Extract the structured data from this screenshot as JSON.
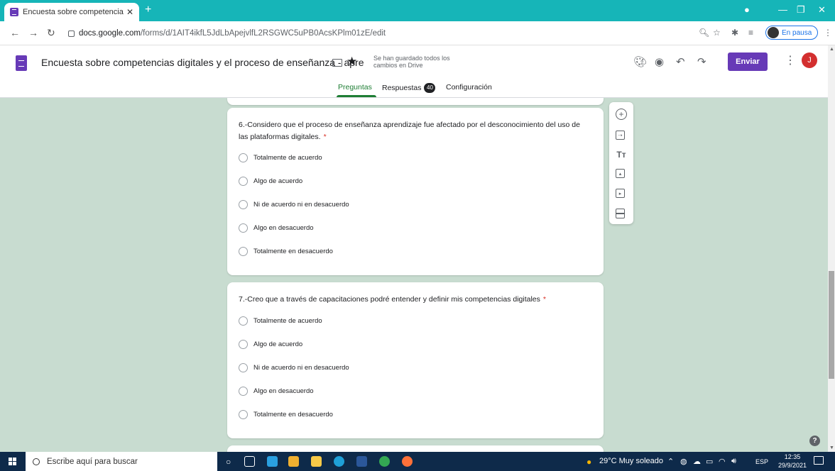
{
  "browser": {
    "tab_title": "Encuesta sobre competencias dig",
    "tab_close": "✕",
    "new_tab": "+",
    "url_host": "docs.google.com",
    "url_path": "/forms/d/1AIT4ikfL5JdLbApejvlfL2RSGWC5uPB0AcsKPlm01zE/edit",
    "profile_status": "En pausa"
  },
  "form_header": {
    "title": "Encuesta sobre competencias digitales y el proceso de enseñanza - apre",
    "save_status_line1": "Se han guardado todos los",
    "save_status_line2": "cambios en Drive",
    "send_label": "Enviar",
    "user_initial": "J",
    "tabs": {
      "questions": "Preguntas",
      "responses": "Respuestas",
      "responses_count": "40",
      "settings": "Configuración"
    }
  },
  "questions": [
    {
      "title": "6.-Considero que el proceso de enseñanza aprendizaje fue afectado por el desconocimiento del uso de las plataformas digitales.",
      "required_mark": "*",
      "options": [
        "Totalmente de acuerdo",
        "Algo de acuerdo",
        "Ni de acuerdo ni en desacuerdo",
        "Algo en desacuerdo",
        "Totalmente en desacuerdo"
      ]
    },
    {
      "title": "7.-Creo que a través de capacitaciones podré entender y definir mis competencias digitales",
      "required_mark": "*",
      "options": [
        "Totalmente de acuerdo",
        "Algo de acuerdo",
        "Ni de acuerdo ni en desacuerdo",
        "Algo en desacuerdo",
        "Totalmente en desacuerdo"
      ]
    }
  ],
  "toolbar_icons": [
    "add-question-icon",
    "import-questions-icon",
    "add-title-icon",
    "add-image-icon",
    "add-video-icon",
    "add-section-icon"
  ],
  "help_label": "?",
  "taskbar": {
    "search_placeholder": "Escribe aquí para buscar",
    "weather": "29°C Muy soleado",
    "language": "ESP",
    "time": "12:35",
    "date": "29/9/2021"
  },
  "colors": {
    "accent": "#673ab7",
    "background": "#c8dcd0",
    "active_tab": "#1e7e34",
    "required": "#d93025",
    "browser_frame": "#16b5b8"
  }
}
